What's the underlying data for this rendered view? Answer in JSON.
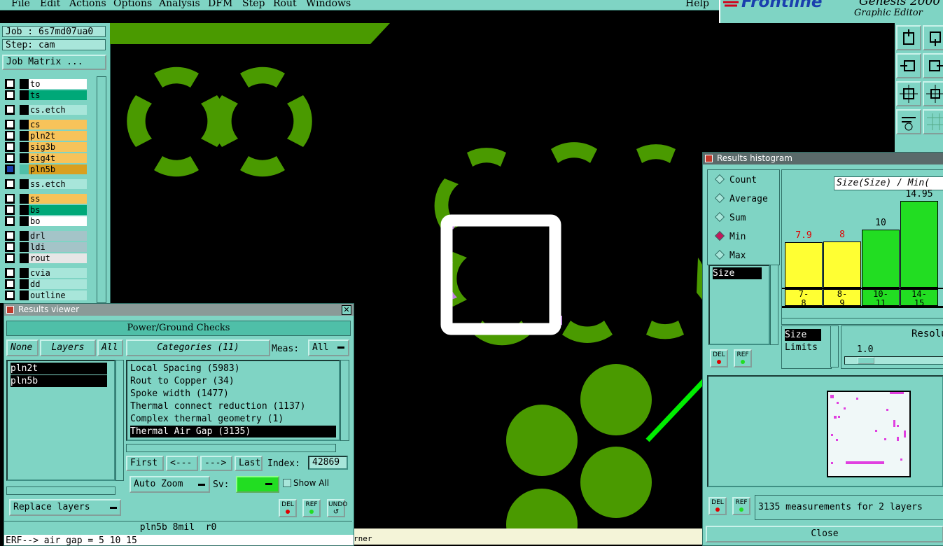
{
  "menu": {
    "items": [
      "File",
      "Edit",
      "Actions",
      "Options",
      "Analysis",
      "DFM",
      "Step",
      "Rout",
      "Windows"
    ],
    "help": "Help"
  },
  "brand": {
    "logo": "Frontline",
    "product": "Genesis 2000",
    "subtitle": "Graphic Editor"
  },
  "job": {
    "job_label": "Job : 6s7md07ua0",
    "step_label": "Step: cam",
    "matrix_button": "Job Matrix ..."
  },
  "layers": [
    {
      "name": "to",
      "color": "#ffffff"
    },
    {
      "name": "ts",
      "color": "#00a878"
    },
    {
      "name": "cs.etch",
      "color": "#a8e6da"
    },
    {
      "name": "cs",
      "color": "#f7c35a"
    },
    {
      "name": "pln2t",
      "color": "#f7c35a"
    },
    {
      "name": "sig3b",
      "color": "#f7c35a"
    },
    {
      "name": "sig4t",
      "color": "#f7c35a"
    },
    {
      "name": "pln5b",
      "color": "#d9a020"
    },
    {
      "name": "ss.etch",
      "color": "#a8e6da"
    },
    {
      "name": "ss",
      "color": "#f7c35a"
    },
    {
      "name": "bs",
      "color": "#00a878"
    },
    {
      "name": "bo",
      "color": "#ffffff"
    },
    {
      "name": "drl",
      "color": "#a4c4c8"
    },
    {
      "name": "ldi",
      "color": "#a4c4c8"
    },
    {
      "name": "rout",
      "color": "#e6e6e6"
    },
    {
      "name": "cvia",
      "color": "#a8e6da"
    },
    {
      "name": "dd",
      "color": "#a8e6da"
    },
    {
      "name": "outline",
      "color": "#a8e6da"
    }
  ],
  "results_viewer": {
    "title": "Results viewer",
    "banner": "Power/Ground Checks",
    "none_btn": "None",
    "layers_btn": "Layers",
    "all_btn": "All",
    "categories_btn": "Categories (11)",
    "meas_label": "Meas:",
    "meas_value": "All",
    "layer_list": [
      "pln2t",
      "pln5b"
    ],
    "categories": [
      "Local Spacing (5983)",
      "Rout to Copper (34)",
      "Spoke width (1477)",
      "Thermal connect reduction (1137)",
      "Complex thermal geometry (1)",
      "Thermal Air Gap (3135)"
    ],
    "first": "First",
    "prev": "<---",
    "next": "--->",
    "last": "Last",
    "index_label": "Index:",
    "index_value": "42869",
    "auto_zoom": "Auto Zoom",
    "sv_label": "Sv:",
    "show_all": "Show All",
    "replace_layers": "Replace layers",
    "del": "DEL",
    "ref": "REF",
    "undo": "UNDO",
    "status_layer": "pln5b 8mil  r0",
    "message": "ERF--> air gap = 5 10 15"
  },
  "canvas": {
    "status_text": "rner"
  },
  "histogram": {
    "title": "Results histogram",
    "modes": [
      "Count",
      "Average",
      "Sum",
      "Min",
      "Max"
    ],
    "selected_mode": "Min",
    "chart_title": "Size(Size) / Min(",
    "field_list": [
      "Size"
    ],
    "resolution_label": "Resolut",
    "size_label": "Size",
    "limits_label": "Limits",
    "resolution_value": "1.0",
    "summary": "3135 measurements for 2 layers",
    "close": "Close",
    "del": "DEL",
    "ref": "REF",
    "chart_data": {
      "type": "bar",
      "categories": [
        "7-8",
        "8-9",
        "10-11",
        "14-15"
      ],
      "values": [
        7.9,
        8,
        10,
        14.95
      ],
      "value_labels": [
        "7.9",
        "8",
        "10",
        "14.95"
      ],
      "tick_top": [
        "7-",
        "8-",
        "10-",
        "14-"
      ],
      "tick_bottom": [
        "8",
        "9",
        "11",
        "15"
      ],
      "bar_colors": [
        "#ffff33",
        "#ffff33",
        "#22dd22",
        "#22dd22"
      ],
      "label_colors": [
        "#e00000",
        "#e00000",
        "#000000",
        "#000000"
      ],
      "ylim": [
        0,
        15
      ]
    }
  },
  "colors": {
    "panel": "#7fd4c4",
    "copper": "#4a9a00",
    "highlight": "#c080e0",
    "arrow": "#00ee00"
  }
}
